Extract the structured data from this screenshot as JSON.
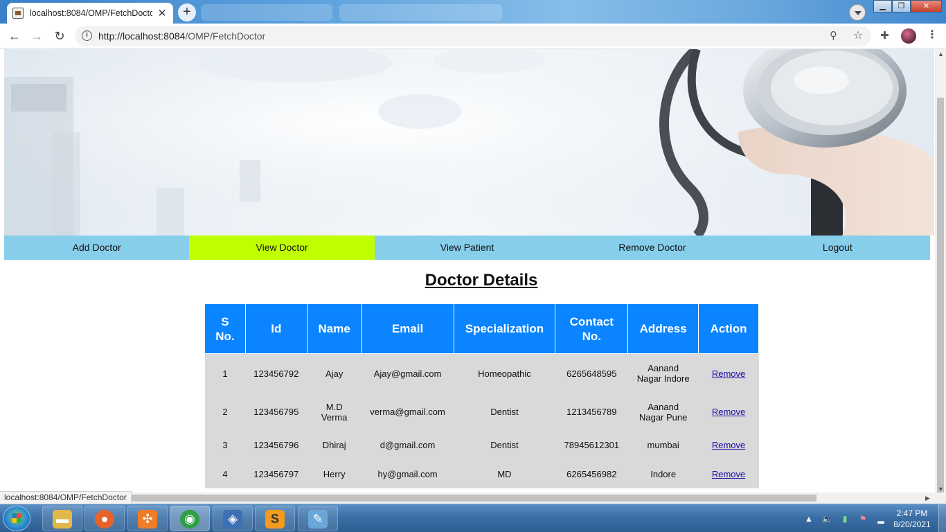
{
  "browser": {
    "tab_title": "localhost:8084/OMP/FetchDoctor",
    "tab_close": "✕",
    "new_tab": "+",
    "url_host": "http://localhost:8084",
    "url_path": "/OMP/FetchDoctor",
    "status_tip": "localhost:8084/OMP/FetchDoctor",
    "buttons": {
      "back": "←",
      "forward": "→",
      "reload": "↻",
      "info": "i",
      "zoom": "⚲",
      "star": "☆",
      "extensions": "✚",
      "menu": "⋮"
    }
  },
  "window_controls": {
    "minimize": "▁",
    "maximize": "❐",
    "close": "✕"
  },
  "nav": {
    "items": [
      {
        "label": "Add Doctor",
        "active": false
      },
      {
        "label": "View Doctor",
        "active": true
      },
      {
        "label": "View Patient",
        "active": false
      },
      {
        "label": "Remove Doctor",
        "active": false
      },
      {
        "label": "Logout",
        "active": false
      }
    ],
    "active_color": "#bfff00",
    "bar_color": "#87ceeb"
  },
  "page": {
    "heading": "Doctor Details"
  },
  "table": {
    "header_color": "#0a84ff",
    "columns": [
      {
        "line1": "S",
        "line2": "No."
      },
      {
        "line1": "Id",
        "line2": ""
      },
      {
        "line1": "Name",
        "line2": ""
      },
      {
        "line1": "Email",
        "line2": ""
      },
      {
        "line1": "Specialization",
        "line2": ""
      },
      {
        "line1": "Contact",
        "line2": "No."
      },
      {
        "line1": "Address",
        "line2": ""
      },
      {
        "line1": "Action",
        "line2": ""
      }
    ],
    "rows": [
      {
        "sno": "1",
        "id": "123456792",
        "name_l1": "Ajay",
        "name_l2": "",
        "email": "Ajay@gmail.com",
        "spec": "Homeopathic",
        "contact": "6265648595",
        "addr_l1": "Aanand",
        "addr_l2": "Nagar Indore",
        "action": "Remove"
      },
      {
        "sno": "2",
        "id": "123456795",
        "name_l1": "M.D",
        "name_l2": "Verma",
        "email": "verma@gmail.com",
        "spec": "Dentist",
        "contact": "1213456789",
        "addr_l1": "Aanand",
        "addr_l2": "Nagar Pune",
        "action": "Remove"
      },
      {
        "sno": "3",
        "id": "123456796",
        "name_l1": "Dhiraj",
        "name_l2": "",
        "email": "d@gmail.com",
        "spec": "Dentist",
        "contact": "78945612301",
        "addr_l1": "mumbai",
        "addr_l2": "",
        "action": "Remove"
      },
      {
        "sno": "4",
        "id": "123456797",
        "name_l1": "Herry",
        "name_l2": "",
        "email": "hy@gmail.com",
        "spec": "MD",
        "contact": "6265456982",
        "addr_l1": "Indore",
        "addr_l2": "",
        "action": "Remove"
      }
    ]
  },
  "taskbar": {
    "apps": [
      {
        "icon": "file-explorer-icon",
        "glyph": "▬",
        "color": "#e3b84a"
      },
      {
        "icon": "firefox-icon",
        "glyph": "●",
        "color": "#e8632b"
      },
      {
        "icon": "xampp-icon",
        "glyph": "✣",
        "color": "#f07c26"
      },
      {
        "icon": "chrome-icon",
        "glyph": "◉",
        "color": "#2f9e44"
      },
      {
        "icon": "virtualbox-icon",
        "glyph": "◈",
        "color": "#3c6fb4"
      },
      {
        "icon": "sublime-text-icon",
        "glyph": "S",
        "color": "#f29b1d"
      },
      {
        "icon": "paint-icon",
        "glyph": "✎",
        "color": "#6aa7d9"
      }
    ],
    "tray": {
      "show_hidden": "▲",
      "volume": "🔈",
      "signal": "▮",
      "network": "⚑",
      "wifi": "▂"
    },
    "clock": {
      "time": "2:47 PM",
      "date": "8/20/2021"
    }
  }
}
